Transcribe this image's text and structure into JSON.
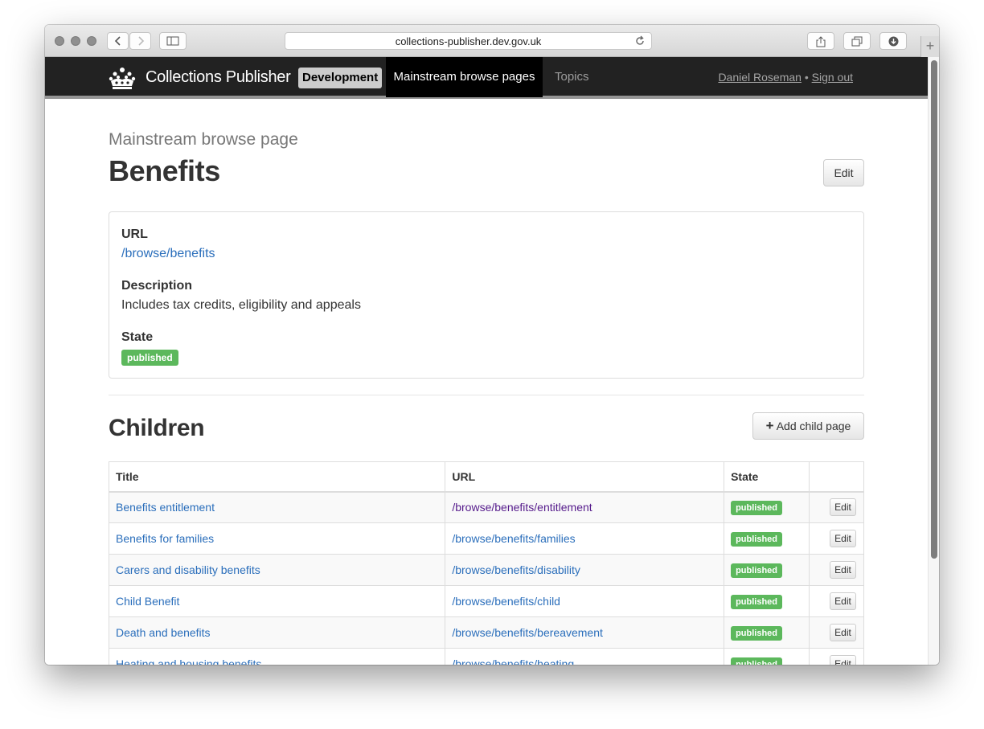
{
  "browser": {
    "url": "collections-publisher.dev.gov.uk"
  },
  "navbar": {
    "brand": "Collections Publisher",
    "environment": "Development",
    "nav_active": "Mainstream browse pages",
    "nav_topics": "Topics",
    "user_name": "Daniel Roseman",
    "separator": " • ",
    "sign_out": "Sign out"
  },
  "page": {
    "subtitle": "Mainstream browse page",
    "title": "Benefits",
    "edit_label": "Edit"
  },
  "details": {
    "url_label": "URL",
    "url_value": "/browse/benefits",
    "description_label": "Description",
    "description_value": "Includes tax credits, eligibility and appeals",
    "state_label": "State",
    "state_value": "published"
  },
  "children": {
    "heading": "Children",
    "add_label": "Add child page",
    "columns": [
      "Title",
      "URL",
      "State",
      ""
    ],
    "rows": [
      {
        "title": "Benefits entitlement",
        "url": "/browse/benefits/entitlement",
        "state": "published",
        "action": "Edit"
      },
      {
        "title": "Benefits for families",
        "url": "/browse/benefits/families",
        "state": "published",
        "action": "Edit"
      },
      {
        "title": "Carers and disability benefits",
        "url": "/browse/benefits/disability",
        "state": "published",
        "action": "Edit"
      },
      {
        "title": "Child Benefit",
        "url": "/browse/benefits/child",
        "state": "published",
        "action": "Edit"
      },
      {
        "title": "Death and benefits",
        "url": "/browse/benefits/bereavement",
        "state": "published",
        "action": "Edit"
      },
      {
        "title": "Heating and housing benefits",
        "url": "/browse/benefits/heating",
        "state": "published",
        "action": "Edit"
      }
    ]
  },
  "colors": {
    "navbar_bg": "#222222",
    "link": "#2a6ebb",
    "visited_link": "#551a8b",
    "published_badge": "#5cb85c"
  }
}
